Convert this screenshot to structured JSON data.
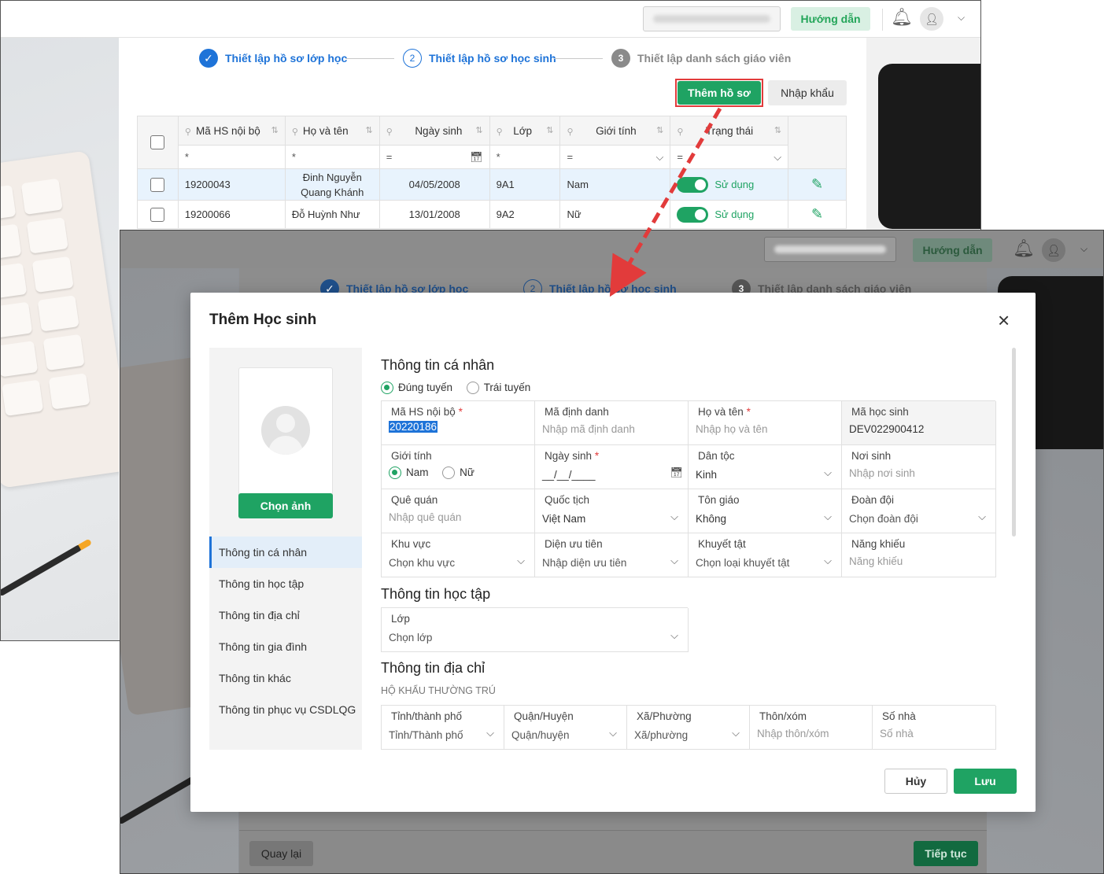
{
  "back": {
    "topbar": {
      "guide_label": "Hướng dẫn"
    },
    "steps": [
      {
        "num": "",
        "label": "Thiết lập hồ sơ lớp học",
        "state": "done"
      },
      {
        "num": "2",
        "label": "Thiết lập hồ sơ học sinh",
        "state": "current"
      },
      {
        "num": "3",
        "label": "Thiết lập danh sách giáo viên",
        "state": "pending"
      }
    ],
    "actions": {
      "add_label": "Thêm hồ sơ",
      "import_label": "Nhập khẩu"
    },
    "table": {
      "headers": [
        "Mã HS nội bộ",
        "Họ và tên",
        "Ngày sinh",
        "Lớp",
        "Giới tính",
        "Trạng thái"
      ],
      "filters": [
        "*",
        "*",
        "=",
        "*",
        "=",
        "="
      ],
      "rows": [
        {
          "code": "19200043",
          "name": "Đinh Nguyễn Quang Khánh",
          "dob": "04/05/2008",
          "class": "9A1",
          "gender": "Nam",
          "status": "Sử dụng",
          "selected": true
        },
        {
          "code": "19200066",
          "name": "Đỗ Huỳnh Như",
          "dob": "13/01/2008",
          "class": "9A2",
          "gender": "Nữ",
          "status": "Sử dụng",
          "selected": false
        }
      ]
    }
  },
  "front": {
    "topbar": {
      "guide_label": "Hướng dẫn"
    },
    "steps": [
      {
        "label": "Thiết lập hồ sơ lớp học"
      },
      {
        "num": "2",
        "label": "Thiết lập hồ sơ học sinh"
      },
      {
        "num": "3",
        "label": "Thiết lập danh sách giáo viên"
      }
    ],
    "footer": {
      "back_label": "Quay lại",
      "next_label": "Tiếp tục"
    }
  },
  "dialog": {
    "title": "Thêm Học sinh",
    "close_icon": "×",
    "choose_photo_label": "Chọn ảnh",
    "nav": [
      "Thông tin cá nhân",
      "Thông tin học tập",
      "Thông tin địa chỉ",
      "Thông tin gia đình",
      "Thông tin khác",
      "Thông tin phục vụ CSDLQG"
    ],
    "personal": {
      "title": "Thông tin cá nhân",
      "admission": [
        {
          "label": "Đúng tuyến",
          "checked": true
        },
        {
          "label": "Trái tuyến",
          "checked": false
        }
      ],
      "internal_code": {
        "label": "Mã HS nội bộ",
        "value": "20220186"
      },
      "id_code": {
        "label": "Mã định danh",
        "placeholder": "Nhập mã định danh"
      },
      "full_name": {
        "label": "Họ và tên",
        "placeholder": "Nhập họ và tên"
      },
      "student_code": {
        "label": "Mã học sinh",
        "value": "DEV022900412"
      },
      "gender": {
        "label": "Giới tính",
        "options": [
          "Nam",
          "Nữ"
        ],
        "selected": "Nam"
      },
      "dob": {
        "label": "Ngày sinh",
        "value": "__/__/____"
      },
      "ethnicity": {
        "label": "Dân tộc",
        "value": "Kinh"
      },
      "birthplace": {
        "label": "Nơi sinh",
        "placeholder": "Nhập nơi sinh"
      },
      "hometown": {
        "label": "Quê quán",
        "placeholder": "Nhập quê quán"
      },
      "nationality": {
        "label": "Quốc tịch",
        "value": "Việt Nam"
      },
      "religion": {
        "label": "Tôn giáo",
        "value": "Không"
      },
      "union": {
        "label": "Đoàn đội",
        "placeholder": "Chọn đoàn đội"
      },
      "region": {
        "label": "Khu vực",
        "placeholder": "Chọn khu vực"
      },
      "priority": {
        "label": "Diện ưu tiên",
        "placeholder": "Nhập diện ưu tiên"
      },
      "disability": {
        "label": "Khuyết tật",
        "placeholder": "Chọn loại khuyết tật"
      },
      "talent": {
        "label": "Năng khiếu",
        "placeholder": "Năng khiếu"
      }
    },
    "study": {
      "title": "Thông tin học tập",
      "class": {
        "label": "Lớp",
        "placeholder": "Chọn lớp"
      }
    },
    "address": {
      "title": "Thông tin địa chỉ",
      "subhead": "HỘ KHẨU THƯỜNG TRÚ",
      "province": {
        "label": "Tỉnh/thành phố",
        "placeholder": "Tỉnh/Thành phố"
      },
      "district": {
        "label": "Quận/Huyện",
        "placeholder": "Quận/huyện"
      },
      "ward": {
        "label": "Xã/Phường",
        "placeholder": "Xã/phường"
      },
      "village": {
        "label": "Thôn/xóm",
        "placeholder": "Nhập thôn/xóm"
      },
      "house": {
        "label": "Số nhà",
        "placeholder": "Số nhà"
      }
    },
    "buttons": {
      "cancel_label": "Hủy",
      "save_label": "Lưu"
    }
  },
  "colors": {
    "accent_green": "#1fa363",
    "accent_blue": "#1e73d8",
    "highlight_red": "#e23b3b"
  }
}
